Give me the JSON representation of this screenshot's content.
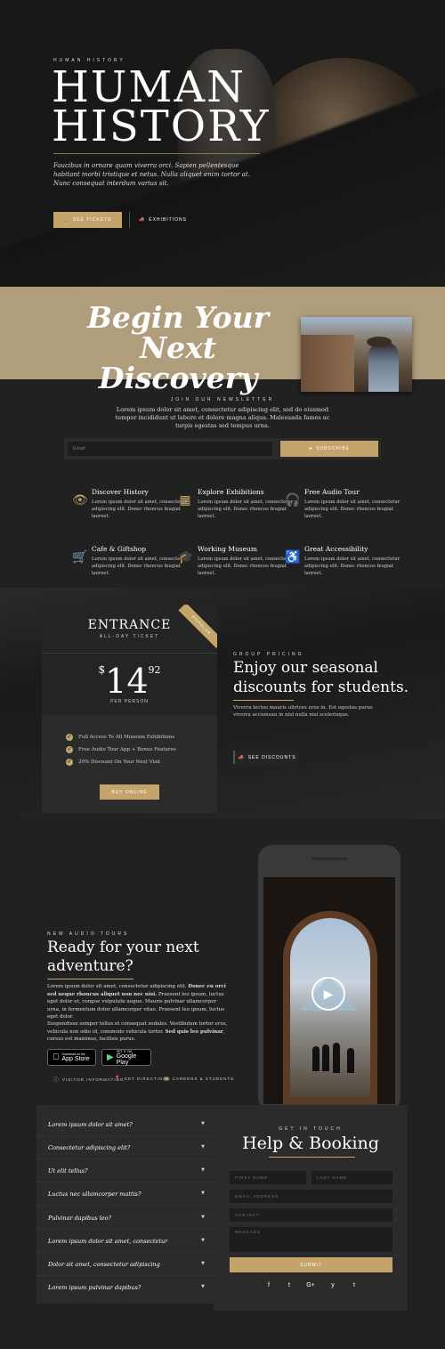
{
  "hero": {
    "eyebrow": "HUMAN HISTORY",
    "title_line1": "HUMAN",
    "title_line2": "HISTORY",
    "text": "Faucibus in ornare quam viverra orci. Sapien pellentesque habitant morbi tristique et netus. Nulla aliquet enim tortor at. Nunc consequat interdum varius sit.",
    "tickets_label": "SEE TICKETS",
    "tickets_icon": "cart-icon",
    "exhibitions_label": "EXHIBITIONS",
    "exhibitions_icon": "megaphone-icon"
  },
  "discovery": {
    "title_line1": "Begin Your Next",
    "title_line2": "Discovery"
  },
  "newsletter": {
    "eyebrow": "JOIN OUR NEWSLETTER",
    "text": "Lorem ipsum dolor sit amet, consectetur adipiscing elit, sed do eiusmod tempor incididunt ut labore et dolore magna aliqua. Malesuada fames ac turpis egestas sed tempus urna.",
    "email_placeholder": "Email",
    "subscribe_label": "SUBSCRIBE"
  },
  "features": [
    {
      "title": "Discover History",
      "text": "Lorem ipsum dolor sit amet, consectetur adipiscing elit. Donec rhoncus feugiat laoreet.",
      "icon": "eye-icon"
    },
    {
      "title": "Explore Exhibitions",
      "text": "Lorem ipsum dolor sit amet, consectetur adipiscing elit. Donec rhoncus feugiat laoreet.",
      "icon": "easel-icon"
    },
    {
      "title": "Free Audio Tour",
      "text": "Lorem ipsum dolor sit amet, consectetur adipiscing elit. Donec rhoncus feugiat laoreet.",
      "icon": "headphones-icon"
    },
    {
      "title": "Cafe & Giftshop",
      "text": "Lorem ipsum dolor sit amet, consectetur adipiscing elit. Donec rhoncus feugiat laoreet.",
      "icon": "cart-icon"
    },
    {
      "title": "Working Museum",
      "text": "Lorem ipsum dolor sit amet, consectetur adipiscing elit. Donec rhoncus feugiat laoreet.",
      "icon": "graduation-cap-icon"
    },
    {
      "title": "Great Accessibility",
      "text": "Lorem ipsum dolor sit amet, consectetur adipiscing elit. Donec rhoncus feugiat laoreet.",
      "icon": "wheelchair-icon"
    }
  ],
  "ticket": {
    "title": "ENTRANCE",
    "subtitle": "ALL-DAY TICKET",
    "ribbon": "POPULAR",
    "currency": "$",
    "price": "14",
    "cents": "92",
    "per": "PER PERSON",
    "features": [
      "Full Access To All Museum Exhibitions",
      "Free Audio Tour App + Bonus Features",
      "20% Discount On Your Next Visit"
    ],
    "buy_label": "BUY ONLINE"
  },
  "group": {
    "eyebrow": "GROUP PRICING",
    "title_line1": "Enjoy our seasonal",
    "title_line2": "discounts for students.",
    "text": "Viverra lectus mauris ultrices eros in. Est egestas purus viverra accumsan in nisl nulla nisi scelerisque.",
    "button_label": "SEE DISCOUNTS"
  },
  "audio": {
    "eyebrow": "NEW AUDIO TOURS",
    "title_line1": "Ready for your next",
    "title_line2": "adventure?",
    "p1_a": "Lorem ipsum dolor sit amet, consectetur adipiscing elit. ",
    "p1_b": "Donec eu orci sed neque rhoncus aliquet non nec nisi.",
    "p1_c": " Praesent leo ipsum, luctus eget dolor et, congue vulputate augue. Mauris pulvinar ullamcorper urna, in fermentum dolor ullamcorper vitae. Praesent leo ipsum, luctus eget dolor.",
    "p2_a": "Suspendisse semper tellus et consequat sodales. Vestibulum tortor eros, vehicula non odio id, commodo vehicula tortor. ",
    "p2_b": "Sed quis leo pulvinar",
    "p2_c": ", cursus est maximus, facilisis purus.",
    "appstore_small": "Download on the",
    "appstore_big": "App Store",
    "google_small": "GET IT ON",
    "google_big": "Google Play",
    "links": [
      {
        "label": "VISITOR INFORMATION",
        "icon": "info-icon"
      },
      {
        "label": "GET DIRECTIONS",
        "icon": "map-pin-icon"
      },
      {
        "label": "CAREERS & STUDENTS",
        "icon": "linkedin-icon"
      }
    ]
  },
  "faq": [
    "Lorem ipsum dolor sit amet?",
    "Consectetur adipiscing elit?",
    "Ut elit tellus?",
    "Luctus nec ullamcorper mattis?",
    "Pulvinar dapibus leo?",
    "Lorem ipsum dolor sit amet, consectetur",
    "Dolor sit amet, consectetur adipiscing",
    "Lorem ipsum pulvinar dapibus?"
  ],
  "contact": {
    "eyebrow": "GET IN TOUCH",
    "title": "Help & Booking",
    "first_name": "FIRST NAME",
    "last_name": "LAST NAME",
    "email": "EMAIL ADDRESS",
    "subject": "SUBJECT",
    "message": "MESSAGE",
    "submit_label": "SUBMIT",
    "social": [
      "f",
      "t",
      "G+",
      "y",
      "t"
    ]
  },
  "colors": {
    "accent": "#c4a46a",
    "band": "#b09d7c",
    "background": "#212121"
  }
}
